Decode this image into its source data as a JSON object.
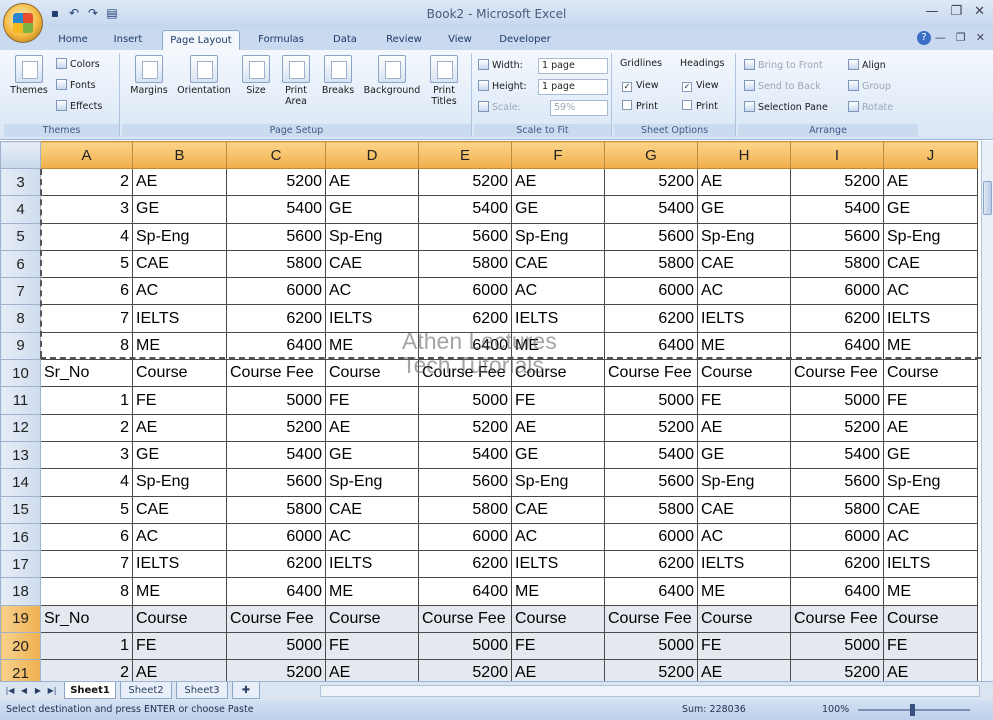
{
  "window": {
    "title": "Book2 - Microsoft Excel",
    "doc_buttons": [
      "—",
      "❐",
      "✕"
    ],
    "win_buttons": [
      "—",
      "❐",
      "✕"
    ],
    "help": "?"
  },
  "qat": [
    {
      "name": "save-icon",
      "glyph": "▪"
    },
    {
      "name": "undo-icon",
      "glyph": "↶"
    },
    {
      "name": "redo-icon",
      "glyph": "↷"
    },
    {
      "name": "print-preview-icon",
      "glyph": "▤"
    }
  ],
  "tabs": [
    "Home",
    "Insert",
    "Page Layout",
    "Formulas",
    "Data",
    "Review",
    "View",
    "Developer"
  ],
  "active_tab": "Page Layout",
  "ribbon": {
    "themes": {
      "label": "Themes",
      "themes_btn": "Themes",
      "colors": "Colors",
      "fonts": "Fonts",
      "effects": "Effects"
    },
    "page_setup": {
      "label": "Page Setup",
      "margins": "Margins",
      "orientation": "Orientation",
      "size": "Size",
      "print_area": "Print Area",
      "breaks": "Breaks",
      "background": "Background",
      "print_titles": "Print Titles"
    },
    "scale_to_fit": {
      "label": "Scale to Fit",
      "width": "Width:",
      "width_val": "1 page",
      "height": "Height:",
      "height_val": "1 page",
      "scale": "Scale:",
      "scale_val": "59%"
    },
    "sheet_options": {
      "label": "Sheet Options",
      "gridlines": "Gridlines",
      "headings": "Headings",
      "view": "View",
      "print": "Print"
    },
    "arrange": {
      "label": "Arrange",
      "bring": "Bring to Front",
      "send": "Send to Back",
      "selection": "Selection Pane",
      "align": "Align",
      "group": "Group",
      "rotate": "Rotate"
    }
  },
  "sheet": {
    "columns": [
      "A",
      "B",
      "C",
      "D",
      "E",
      "F",
      "G",
      "H",
      "I",
      "J"
    ],
    "rows": [
      {
        "n": "3",
        "c": [
          "2",
          "AE",
          "5200",
          "AE",
          "5200",
          "AE",
          "5200",
          "AE",
          "5200",
          "AE"
        ]
      },
      {
        "n": "4",
        "c": [
          "3",
          "GE",
          "5400",
          "GE",
          "5400",
          "GE",
          "5400",
          "GE",
          "5400",
          "GE"
        ]
      },
      {
        "n": "5",
        "c": [
          "4",
          "Sp-Eng",
          "5600",
          "Sp-Eng",
          "5600",
          "Sp-Eng",
          "5600",
          "Sp-Eng",
          "5600",
          "Sp-Eng"
        ]
      },
      {
        "n": "6",
        "c": [
          "5",
          "CAE",
          "5800",
          "CAE",
          "5800",
          "CAE",
          "5800",
          "CAE",
          "5800",
          "CAE"
        ]
      },
      {
        "n": "7",
        "c": [
          "6",
          "AC",
          "6000",
          "AC",
          "6000",
          "AC",
          "6000",
          "AC",
          "6000",
          "AC"
        ]
      },
      {
        "n": "8",
        "c": [
          "7",
          "IELTS",
          "6200",
          "IELTS",
          "6200",
          "IELTS",
          "6200",
          "IELTS",
          "6200",
          "IELTS"
        ]
      },
      {
        "n": "9",
        "c": [
          "8",
          "ME",
          "6400",
          "ME",
          "6400",
          "ME",
          "6400",
          "ME",
          "6400",
          "ME"
        ]
      },
      {
        "n": "10",
        "c": [
          "Sr_No",
          "Course",
          "Course Fee",
          "Course",
          "Course Fee",
          "Course",
          "Course Fee",
          "Course",
          "Course Fee",
          "Course"
        ]
      },
      {
        "n": "11",
        "c": [
          "1",
          "FE",
          "5000",
          "FE",
          "5000",
          "FE",
          "5000",
          "FE",
          "5000",
          "FE"
        ]
      },
      {
        "n": "12",
        "c": [
          "2",
          "AE",
          "5200",
          "AE",
          "5200",
          "AE",
          "5200",
          "AE",
          "5200",
          "AE"
        ]
      },
      {
        "n": "13",
        "c": [
          "3",
          "GE",
          "5400",
          "GE",
          "5400",
          "GE",
          "5400",
          "GE",
          "5400",
          "GE"
        ]
      },
      {
        "n": "14",
        "c": [
          "4",
          "Sp-Eng",
          "5600",
          "Sp-Eng",
          "5600",
          "Sp-Eng",
          "5600",
          "Sp-Eng",
          "5600",
          "Sp-Eng"
        ]
      },
      {
        "n": "15",
        "c": [
          "5",
          "CAE",
          "5800",
          "CAE",
          "5800",
          "CAE",
          "5800",
          "CAE",
          "5800",
          "CAE"
        ]
      },
      {
        "n": "16",
        "c": [
          "6",
          "AC",
          "6000",
          "AC",
          "6000",
          "AC",
          "6000",
          "AC",
          "6000",
          "AC"
        ]
      },
      {
        "n": "17",
        "c": [
          "7",
          "IELTS",
          "6200",
          "IELTS",
          "6200",
          "IELTS",
          "6200",
          "IELTS",
          "6200",
          "IELTS"
        ]
      },
      {
        "n": "18",
        "c": [
          "8",
          "ME",
          "6400",
          "ME",
          "6400",
          "ME",
          "6400",
          "ME",
          "6400",
          "ME"
        ]
      },
      {
        "n": "19",
        "c": [
          "Sr_No",
          "Course",
          "Course Fee",
          "Course",
          "Course Fee",
          "Course",
          "Course Fee",
          "Course",
          "Course Fee",
          "Course"
        ]
      },
      {
        "n": "20",
        "c": [
          "1",
          "FE",
          "5000",
          "FE",
          "5000",
          "FE",
          "5000",
          "FE",
          "5000",
          "FE"
        ]
      },
      {
        "n": "21",
        "c": [
          "2",
          "AE",
          "5200",
          "AE",
          "5200",
          "AE",
          "5200",
          "AE",
          "5200",
          "AE"
        ]
      }
    ],
    "selected_rows": [
      "19",
      "20",
      "21"
    ]
  },
  "watermark": {
    "line1": "Athen Lectures",
    "line2": "Tech Tutorials"
  },
  "sheet_tabs": [
    "Sheet1",
    "Sheet2",
    "Sheet3"
  ],
  "active_sheet": "Sheet1",
  "status": {
    "message": "Select destination and press ENTER or choose Paste",
    "sum": "Sum: 228036",
    "zoom": "100%"
  }
}
